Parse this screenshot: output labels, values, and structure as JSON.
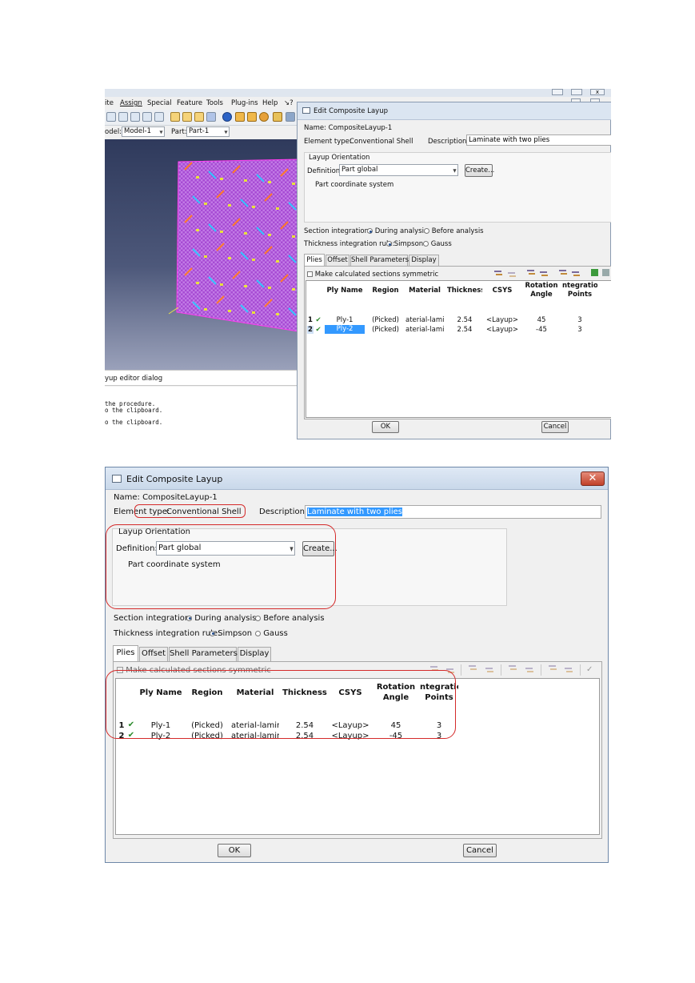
{
  "top_window": {
    "menu": [
      "ite",
      "Assign",
      "Special",
      "Feature",
      "Tools",
      "Plug-ins",
      "Help",
      "↘?"
    ],
    "model_label": "odel:",
    "model_value": "Model-1",
    "part_label": "Part:",
    "part_value": "Part-1",
    "status_text": "yup editor dialog",
    "messages": [
      " the procedure.",
      "o the clipboard.",
      "o the clipboard."
    ]
  },
  "dialog": {
    "title": "Edit Composite Layup",
    "name_label": "Name:",
    "name_value": "CompositeLayup-1",
    "element_type_label": "Element type:",
    "element_type_value": "Conventional Shell",
    "description_label": "Description:",
    "description_value": "Laminate with two plies",
    "orientation_group": "Layup Orientation",
    "definition_label": "Definition:",
    "definition_value": "Part global",
    "create_button": "Create...",
    "coord_text": "Part coordinate system",
    "section_integration_label": "Section integration:",
    "section_options": [
      "During analysis",
      "Before analysis"
    ],
    "section_selected": "During analysis",
    "thickness_rule_label": "Thickness integration rule:",
    "thickness_options": [
      "Simpson",
      "Gauss"
    ],
    "thickness_selected": "Simpson",
    "tabs": [
      "Plies",
      "Offset",
      "Shell Parameters",
      "Display"
    ],
    "active_tab": "Plies",
    "symmetric_label": "Make calculated sections symmetric",
    "columns": [
      "Ply Name",
      "Region",
      "Material",
      "Thickness",
      "CSYS",
      "Rotation Angle",
      "Integration Points"
    ],
    "columns_visible": {
      "rotation_line1": "Rotation",
      "rotation_line2": "Angle",
      "integration_line1": "ntegration",
      "integration_line2": "Points"
    },
    "rows": [
      {
        "num": "1",
        "check": "✔",
        "ply": "Ply-1",
        "region": "(Picked)",
        "material": "aterial-lamina",
        "thickness": "2.54",
        "csys": "<Layup>",
        "angle": "45",
        "points": "3"
      },
      {
        "num": "2",
        "check": "✔",
        "ply": "Ply-2",
        "region": "(Picked)",
        "material": "aterial-lamina",
        "thickness": "2.54",
        "csys": "<Layup>",
        "angle": "-45",
        "points": "3"
      }
    ],
    "ok_button": "OK",
    "cancel_button": "Cancel"
  },
  "colors": {
    "annotation_red": "#d42a2a",
    "selection_blue": "#3399ff",
    "titlebar_blue": "#dbe5f1",
    "mesh_magenta": "#b04ad8"
  }
}
